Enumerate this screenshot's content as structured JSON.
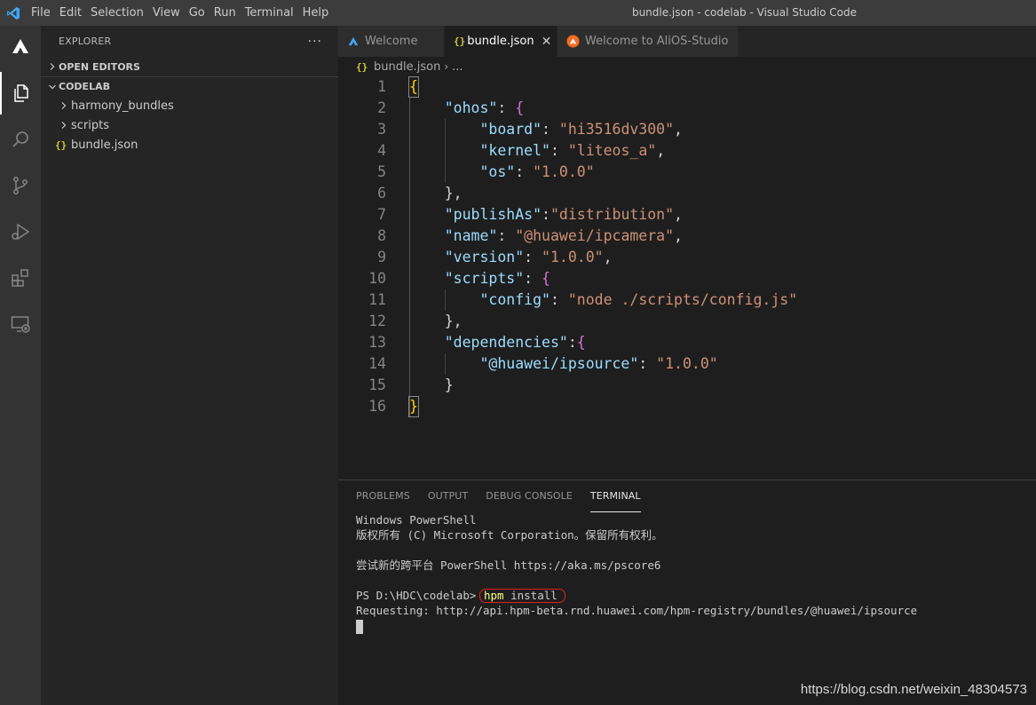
{
  "titlebar": {
    "menu": [
      "File",
      "Edit",
      "Selection",
      "View",
      "Go",
      "Run",
      "Terminal",
      "Help"
    ],
    "window_title": "bundle.json - codelab - Visual Studio Code"
  },
  "activity": {
    "items": [
      "explorer",
      "search",
      "source-control",
      "run-debug",
      "extensions",
      "remote-explorer"
    ]
  },
  "sidebar": {
    "title": "EXPLORER",
    "more": "···",
    "open_editors": "OPEN EDITORS",
    "folder": "CODELAB",
    "tree": [
      {
        "label": "harmony_bundles",
        "type": "folder"
      },
      {
        "label": "scripts",
        "type": "folder"
      },
      {
        "label": "bundle.json",
        "type": "file"
      }
    ],
    "json_icon": "{}"
  },
  "tabs": [
    {
      "label": "Welcome",
      "icon": "alios-icon",
      "active": false
    },
    {
      "label": "bundle.json",
      "icon": "json-icon",
      "active": true
    },
    {
      "label": "Welcome to AliOS-Studio",
      "icon": "alios-studio-icon",
      "active": false
    }
  ],
  "tab_close": "✕",
  "breadcrumb": {
    "file": "bundle.json",
    "sep": "›",
    "more": "..."
  },
  "editor": {
    "lines": [
      {
        "n": "1"
      },
      {
        "n": "2"
      },
      {
        "n": "3"
      },
      {
        "n": "4"
      },
      {
        "n": "5"
      },
      {
        "n": "6"
      },
      {
        "n": "7"
      },
      {
        "n": "8"
      },
      {
        "n": "9"
      },
      {
        "n": "10"
      },
      {
        "n": "11"
      },
      {
        "n": "12"
      },
      {
        "n": "13"
      },
      {
        "n": "14"
      },
      {
        "n": "15"
      },
      {
        "n": "16"
      }
    ],
    "code": {
      "l1_open": "{",
      "ohos_key": "\"ohos\"",
      "board_key": "\"board\"",
      "board_val": "\"hi3516dv300\"",
      "kernel_key": "\"kernel\"",
      "kernel_val": "\"liteos_a\"",
      "os_key": "\"os\"",
      "os_val": "\"1.0.0\"",
      "publish_key": "\"publishAs\"",
      "publish_val": "\"distribution\"",
      "name_key": "\"name\"",
      "name_val": "\"@huawei/ipcamera\"",
      "version_key": "\"version\"",
      "version_val": "\"1.0.0\"",
      "scripts_key": "\"scripts\"",
      "config_key": "\"config\"",
      "config_val": "\"node ./scripts/config.js\"",
      "deps_key": "\"dependencies\"",
      "ipsource_key": "\"@huawei/ipsource\"",
      "ipsource_val": "\"1.0.0\"",
      "l16_close": "}"
    }
  },
  "panel": {
    "tabs": [
      "PROBLEMS",
      "OUTPUT",
      "DEBUG CONSOLE",
      "TERMINAL"
    ],
    "active_tab": "TERMINAL",
    "terminal": {
      "line1": "Windows PowerShell",
      "line2": "版权所有 (C) Microsoft Corporation。保留所有权利。",
      "line3": "尝试新的跨平台 PowerShell https://aka.ms/pscore6",
      "prompt": "PS D:\\HDC\\codelab> ",
      "command_name": "hpm",
      "command_args": " install",
      "line5": "Requesting: http://api.hpm-beta.rnd.huawei.com/hpm-registry/bundles/@huawei/ipsource"
    }
  },
  "watermark": "https://blog.csdn.net/weixin_48304573",
  "colors": {
    "titlebar": "#3c3c3c",
    "activitybar": "#333333",
    "sidebar": "#252526",
    "editor": "#1e1e1e",
    "json_key": "#9cdcfe",
    "json_string": "#ce9178",
    "bracket": "#ffd700",
    "vscode_blue": "#3ea6f5",
    "annotation_red": "#e02020"
  }
}
